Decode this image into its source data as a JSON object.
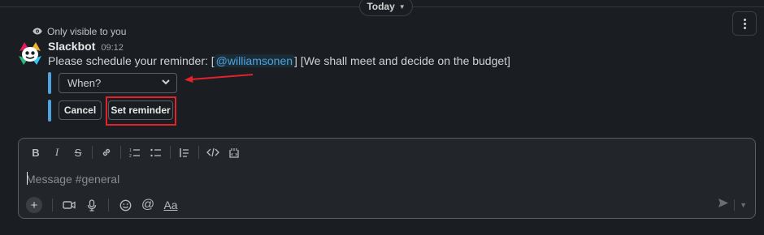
{
  "divider": {
    "date_label": "Today"
  },
  "notice": {
    "text": "Only visible to you"
  },
  "message": {
    "sender": "Slackbot",
    "time": "09:12",
    "text_before": "Please schedule your reminder: [",
    "mention": "@williamsonen",
    "text_after": "] [We shall meet and decide on the budget]"
  },
  "reminder": {
    "select_value": "When?",
    "cancel_label": "Cancel",
    "set_label": "Set reminder"
  },
  "composer": {
    "placeholder": "Message #general",
    "format_label": "Aa"
  },
  "colors": {
    "accent": "#4fa3e0",
    "annotation": "#e3222b",
    "background": "#1a1d21"
  },
  "icons": {
    "avatar": "slackbot-icon",
    "visibility": "eye-icon",
    "toolbar": [
      "bold-icon",
      "italic-icon",
      "strikethrough-icon",
      "link-icon",
      "ordered-list-icon",
      "bulleted-list-icon",
      "blockquote-icon",
      "code-icon",
      "code-block-icon"
    ],
    "bottom": [
      "plus-icon",
      "video-icon",
      "microphone-icon",
      "emoji-icon",
      "mention-icon",
      "format-icon",
      "send-icon",
      "chevron-down-icon"
    ]
  }
}
